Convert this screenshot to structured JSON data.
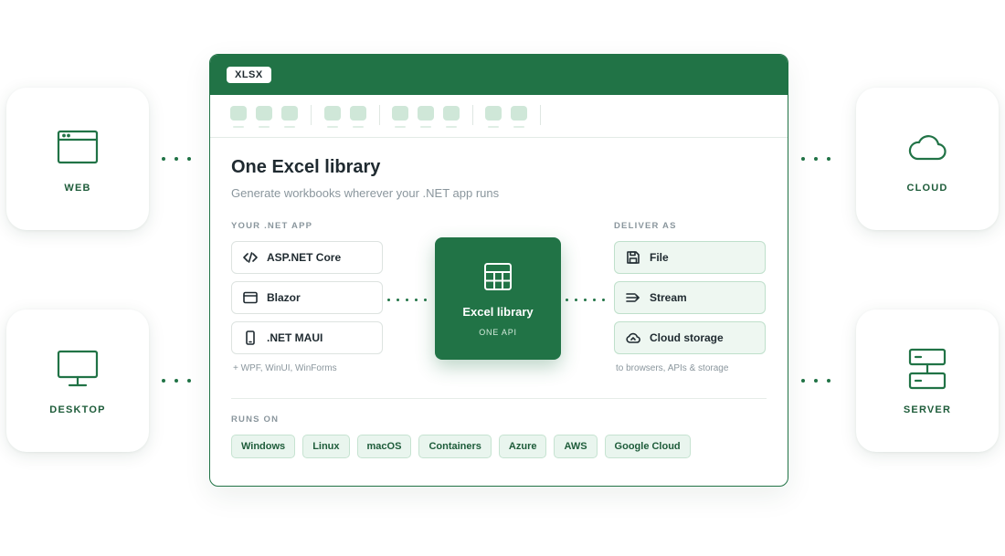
{
  "colors": {
    "accent": "#217346",
    "accent_light": "#e9f5ee",
    "muted_text": "#8a969d"
  },
  "sides": {
    "web": {
      "label": "WEB",
      "icon": "browser-window-icon"
    },
    "desktop": {
      "label": "DESKTOP",
      "icon": "monitor-icon"
    },
    "cloud": {
      "label": "CLOUD",
      "icon": "cloud-icon"
    },
    "server": {
      "label": "SERVER",
      "icon": "server-icon"
    }
  },
  "window": {
    "badge": "XLSX",
    "title": "One Excel library",
    "subtitle": "Generate workbooks wherever your .NET app runs",
    "app_section_label": "YOUR .NET APP",
    "apps": [
      {
        "label": "ASP.NET Core",
        "icon": "code-icon"
      },
      {
        "label": "Blazor",
        "icon": "browser-icon"
      },
      {
        "label": ".NET MAUI",
        "icon": "phone-icon"
      }
    ],
    "apps_note": "+ WPF, WinUI, WinForms",
    "center": {
      "title": "Excel library",
      "subtitle": "ONE API",
      "icon": "table-icon"
    },
    "deliver_section_label": "DELIVER AS",
    "deliverables": [
      {
        "label": "File",
        "icon": "save-icon"
      },
      {
        "label": "Stream",
        "icon": "stream-icon"
      },
      {
        "label": "Cloud storage",
        "icon": "cloud-upload-icon"
      }
    ],
    "deliver_note": "to browsers, APIs & storage",
    "runs_on_label": "RUNS ON",
    "platforms": [
      "Windows",
      "Linux",
      "macOS",
      "Containers",
      "Azure",
      "AWS",
      "Google Cloud"
    ]
  }
}
